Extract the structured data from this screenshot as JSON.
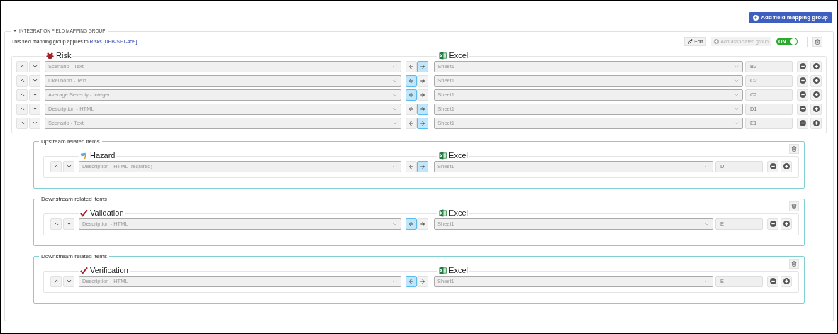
{
  "header_button": "Add field mapping group",
  "group": {
    "title": "INTEGRATION FIELD MAPPING GROUP",
    "expanded": true,
    "applies_text": "This field mapping group applies to",
    "link": "Risks",
    "link_id": "[DEB-SET-459]",
    "edit": "Edit",
    "add_associated": {
      "label": "Add associated group",
      "disabled": true
    },
    "toggle": {
      "label": "ON",
      "on": true
    },
    "mapping": {
      "source": {
        "label": "Risk",
        "kind": "risk"
      },
      "target": {
        "label": "Excel",
        "kind": "excel"
      },
      "rows": [
        {
          "field": "Scenario - Text",
          "export_selected": true,
          "sheet": "Sheet1",
          "cell": "B2"
        },
        {
          "field": "Likelihood - Text",
          "export_selected": false,
          "sheet": "Sheet1",
          "cell": "C2"
        },
        {
          "field": "Average Severity - Integer",
          "export_selected": false,
          "sheet": "Sheet1",
          "cell": "C2"
        },
        {
          "field": "Description - HTML",
          "export_selected": true,
          "sheet": "Sheet1",
          "cell": "D1"
        },
        {
          "field": "Scenario - Text",
          "export_selected": true,
          "sheet": "Sheet1",
          "cell": "E1"
        }
      ]
    },
    "related": [
      {
        "title": "Upstream related items",
        "source": {
          "label": "Hazard",
          "kind": "hazard"
        },
        "target": {
          "label": "Excel",
          "kind": "excel"
        },
        "rows": [
          {
            "field": "Description - HTML (required)",
            "export_selected": true,
            "sheet": "Sheet1",
            "cell": "D"
          }
        ]
      },
      {
        "title": "Downstream related items",
        "source": {
          "label": "Validation",
          "kind": "check"
        },
        "target": {
          "label": "Excel",
          "kind": "excel"
        },
        "rows": [
          {
            "field": "Description - HTML",
            "export_selected": false,
            "sheet": "Sheet1",
            "cell": "E"
          }
        ]
      },
      {
        "title": "Downstream related items",
        "source": {
          "label": "Verification",
          "kind": "check"
        },
        "target": {
          "label": "Excel",
          "kind": "excel"
        },
        "rows": [
          {
            "field": "Description - HTML",
            "export_selected": false,
            "sheet": "Sheet1",
            "cell": "E"
          }
        ]
      }
    ]
  }
}
